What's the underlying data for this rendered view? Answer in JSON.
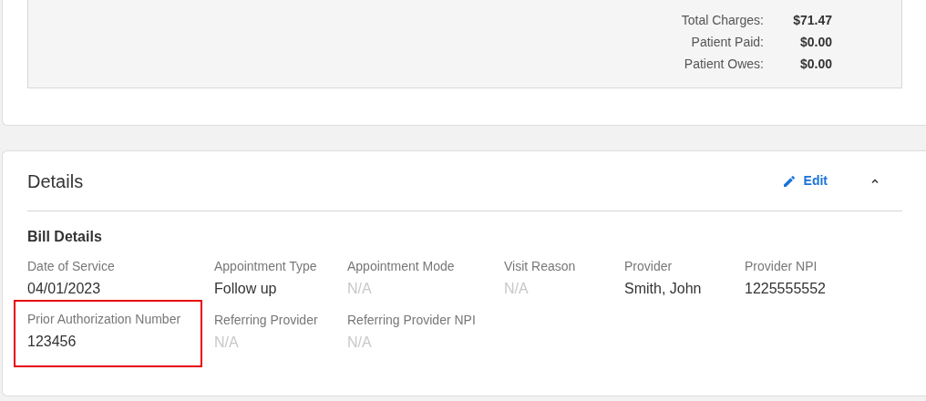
{
  "summary": {
    "rows": [
      {
        "label": "Total Charges:",
        "value": "$71.47"
      },
      {
        "label": "Patient Paid:",
        "value": "$0.00"
      },
      {
        "label": "Patient Owes:",
        "value": "$0.00"
      }
    ]
  },
  "details": {
    "title": "Details",
    "edit_label": "Edit",
    "expanded": true,
    "section_title": "Bill Details",
    "fields": [
      {
        "label": "Date of Service",
        "value": "04/01/2023",
        "muted": false,
        "highlighted": false
      },
      {
        "label": "Appointment Type",
        "value": "Follow up",
        "muted": false,
        "highlighted": false
      },
      {
        "label": "Appointment Mode",
        "value": "N/A",
        "muted": true,
        "highlighted": false
      },
      {
        "label": "Visit Reason",
        "value": "N/A",
        "muted": true,
        "highlighted": false
      },
      {
        "label": "Provider",
        "value": "Smith, John",
        "muted": false,
        "highlighted": false
      },
      {
        "label": "Provider NPI",
        "value": "1225555552",
        "muted": false,
        "highlighted": false
      },
      {
        "label": "Prior Authorization Number",
        "value": "123456",
        "muted": false,
        "highlighted": true
      },
      {
        "label": "Referring Provider",
        "value": "N/A",
        "muted": true,
        "highlighted": false
      },
      {
        "label": "Referring Provider NPI",
        "value": "N/A",
        "muted": true,
        "highlighted": false
      }
    ]
  }
}
